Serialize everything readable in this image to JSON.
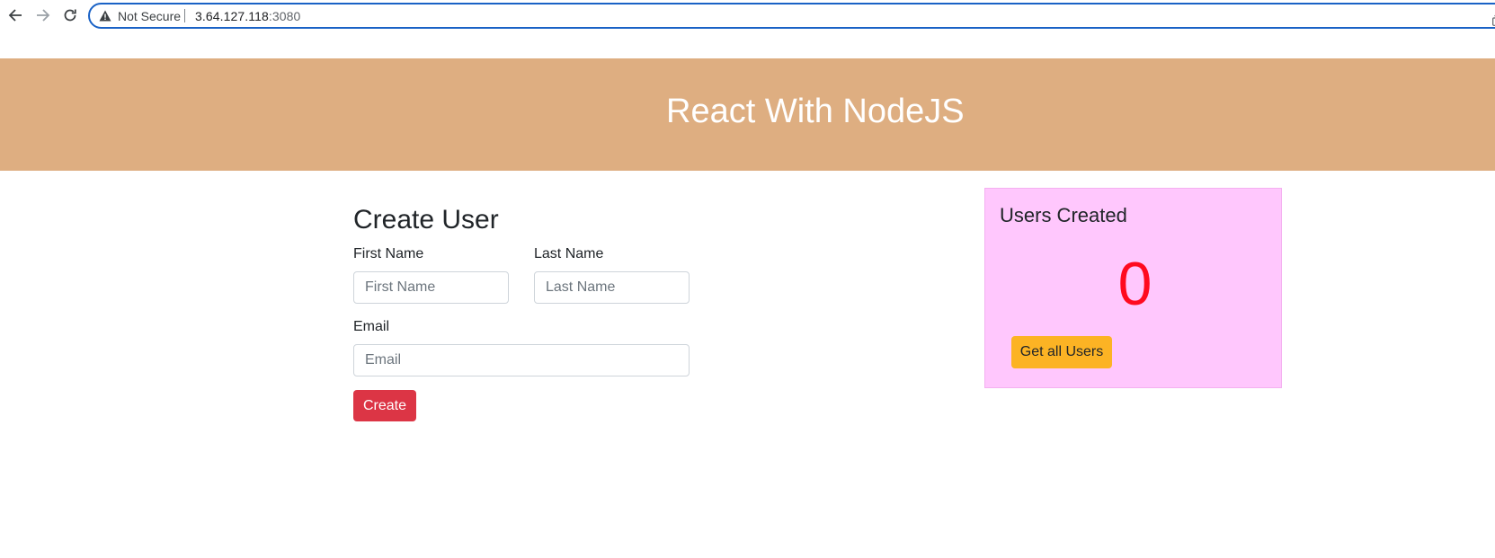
{
  "browser": {
    "security_label": "Not Secure",
    "url_host": "3.64.127.118",
    "url_port": ":3080",
    "icons": [
      "back-arrow-icon",
      "forward-arrow-icon",
      "reload-icon",
      "warning-icon",
      "share-icon"
    ]
  },
  "header": {
    "title": "React With NodeJS",
    "background": "#deae81"
  },
  "form": {
    "heading": "Create User",
    "first_name_label": "First Name",
    "first_name_placeholder": "First Name",
    "first_name_value": "",
    "last_name_label": "Last Name",
    "last_name_placeholder": "Last Name",
    "last_name_value": "",
    "email_label": "Email",
    "email_placeholder": "Email",
    "email_value": "",
    "create_button": "Create",
    "create_button_color": "#dc3545"
  },
  "users_card": {
    "heading": "Users Created",
    "count": "0",
    "count_color": "#ff0a1f",
    "get_all_button": "Get all Users",
    "get_all_button_color": "#fcb324",
    "background": "#ffc7fd"
  }
}
